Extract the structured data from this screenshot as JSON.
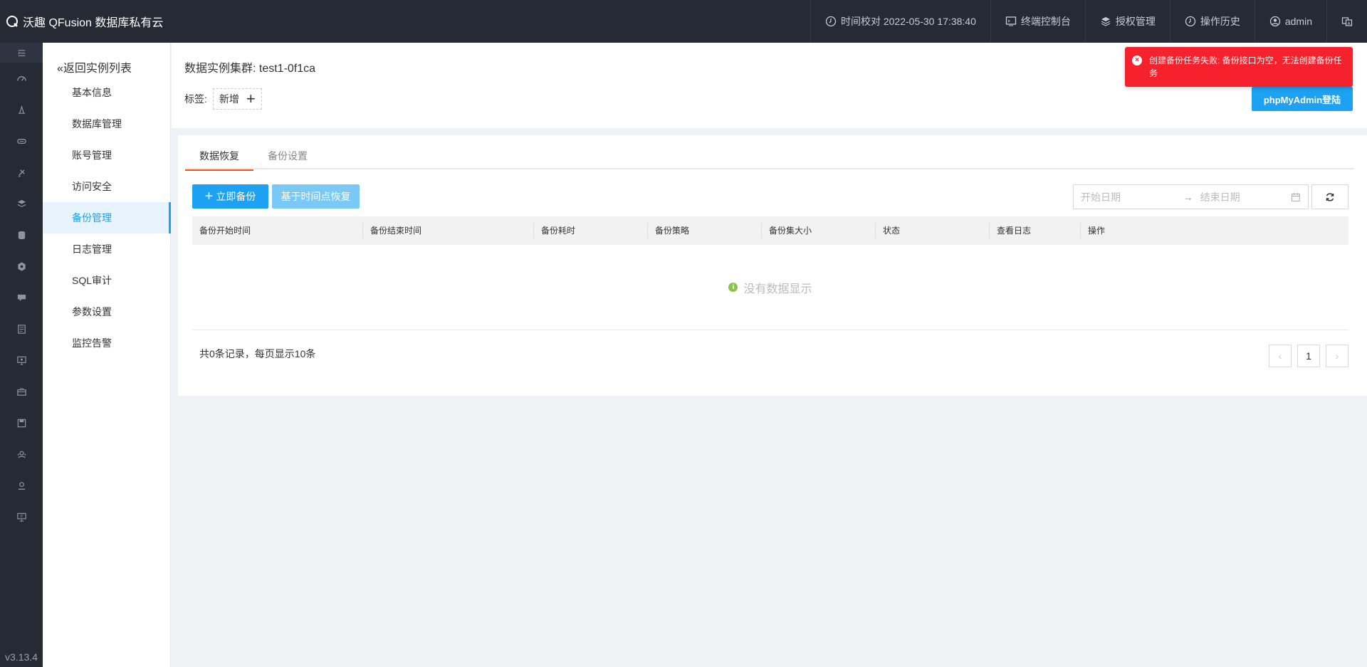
{
  "header": {
    "brand": "沃趣 QFusion 数据库私有云",
    "time_sync": "时间校对 2022-05-30 17:38:40",
    "terminal": "终端控制台",
    "license": "授权管理",
    "history": "操作历史",
    "user": "admin"
  },
  "iconbar": {
    "icons": [
      "menu-toggle-icon",
      "dashboard-icon",
      "cluster-icon",
      "storage-icon",
      "satellite-icon",
      "layers-icon",
      "database-icon",
      "hexagon-icon",
      "chat-icon",
      "document-icon",
      "monitor-icon",
      "briefcase-icon",
      "save-icon",
      "users-icon",
      "user-badge-icon",
      "presentation-icon"
    ],
    "version": "v3.13.4"
  },
  "submenu": {
    "back": "返回实例列表",
    "items": [
      "基本信息",
      "数据库管理",
      "账号管理",
      "访问安全",
      "备份管理",
      "日志管理",
      "SQL审计",
      "参数设置",
      "监控告警"
    ],
    "active_index": 4
  },
  "headcard": {
    "cluster_label": "数据实例集群: test1-0f1ca",
    "tags_label": "标签:",
    "tag_add": "新增",
    "phpmyadmin": "phpMyAdmin登陆"
  },
  "toast": {
    "message": "创建备份任务失败: 备份接口为空，无法创建备份任务",
    "color": "#f5222d"
  },
  "tabs": [
    "数据恢复",
    "备份设置"
  ],
  "toolbar": {
    "backup_now": "立即备份",
    "pitr": "基于时间点恢复",
    "start_date_placeholder": "开始日期",
    "end_date_placeholder": "结束日期"
  },
  "table": {
    "columns": [
      "备份开始时间",
      "备份结束时间",
      "备份耗时",
      "备份策略",
      "备份集大小",
      "状态",
      "查看日志",
      "操作"
    ],
    "rows": [],
    "empty_text": "没有数据显示"
  },
  "pagination": {
    "summary": "共0条记录，每页显示10条",
    "current_page": "1"
  },
  "colors": {
    "primary": "#1da1f2",
    "header_bg": "#262a35",
    "tab_active": "#f4511e"
  }
}
